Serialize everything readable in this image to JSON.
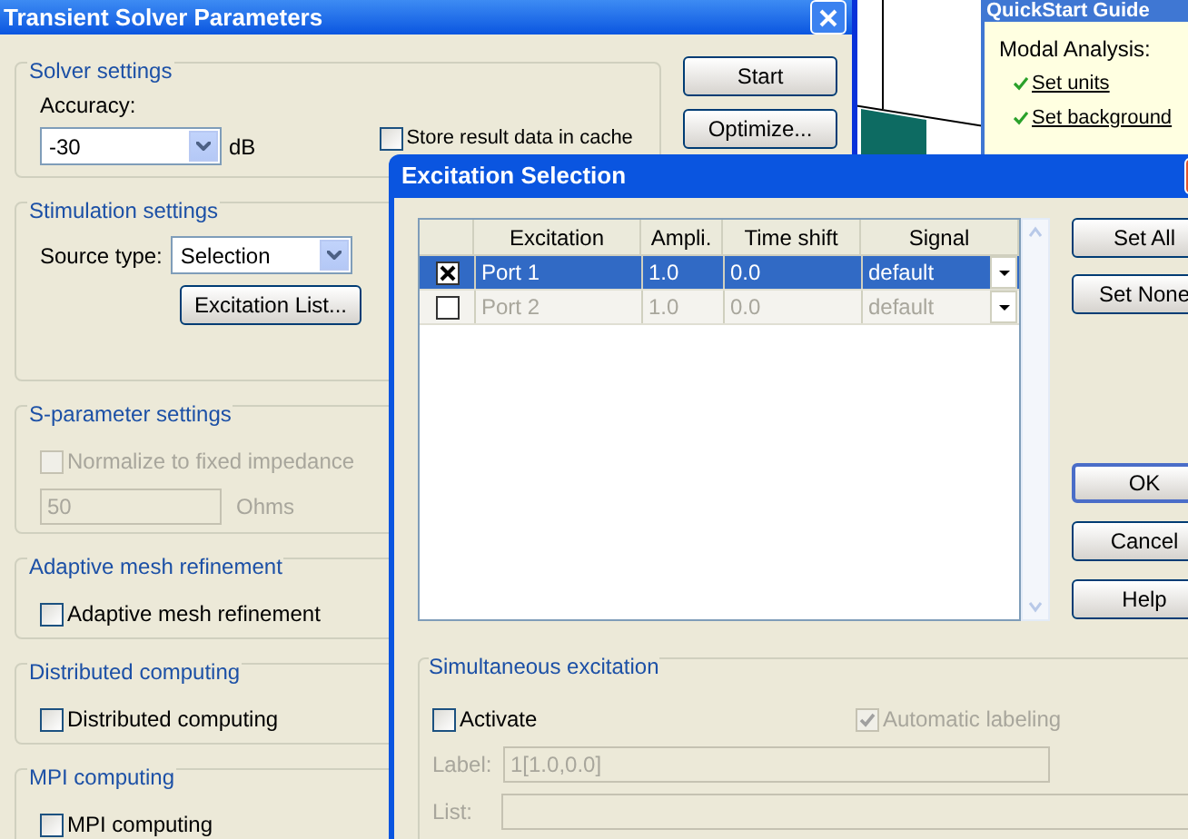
{
  "main_window": {
    "title": "Transient Solver Parameters",
    "groups": [
      {
        "kind": "solver",
        "title": "Solver settings",
        "label": "Accuracy:",
        "value": "-30",
        "unit": "dB",
        "checkbox": {
          "label": "Store result data in cache",
          "checked": false
        }
      },
      {
        "kind": "stimulation",
        "title": "Stimulation settings",
        "label": "Source type:",
        "value": "Selection",
        "button": "Excitation List..."
      },
      {
        "kind": "sparam",
        "title": "S-parameter settings",
        "checkbox": {
          "label": "Normalize to fixed impedance",
          "checked": false,
          "disabled": true
        },
        "value": "50",
        "unit": "Ohms"
      },
      {
        "kind": "check",
        "title": "Adaptive mesh refinement",
        "checkbox": {
          "label": "Adaptive mesh refinement",
          "checked": false
        }
      },
      {
        "kind": "check",
        "title": "Distributed computing",
        "checkbox": {
          "label": "Distributed computing",
          "checked": false
        }
      },
      {
        "kind": "check",
        "title": "MPI computing",
        "checkbox": {
          "label": "MPI computing",
          "checked": false
        }
      }
    ],
    "buttons": [
      "Start",
      "Optimize..."
    ]
  },
  "quickstart": {
    "title": "QuickStart Guide",
    "heading": "Modal Analysis:",
    "links": [
      "Set units",
      "Set background"
    ]
  },
  "dialog": {
    "title": "Excitation Selection",
    "table": {
      "columns": [
        "Excitation",
        "Ampli.",
        "Time shift",
        "Signal"
      ],
      "rows": [
        {
          "selected": true,
          "checked": true,
          "cells": [
            "Port 1",
            "1.0",
            "0.0",
            "default"
          ]
        },
        {
          "selected": false,
          "checked": false,
          "cells": [
            "Port 2",
            "1.0",
            "0.0",
            "default"
          ]
        }
      ]
    },
    "side_buttons": [
      "Set All",
      "Set None"
    ],
    "bottom_buttons": [
      "OK",
      "Cancel",
      "Help"
    ],
    "simultaneous": {
      "title": "Simultaneous excitation",
      "activate": {
        "label": "Activate",
        "checked": false
      },
      "auto_label": {
        "label": "Automatic labeling",
        "checked": true,
        "disabled": true
      },
      "label_field": {
        "label": "Label:",
        "value": "1[1.0,0.0]"
      },
      "list_field": {
        "label": "List:"
      }
    }
  }
}
